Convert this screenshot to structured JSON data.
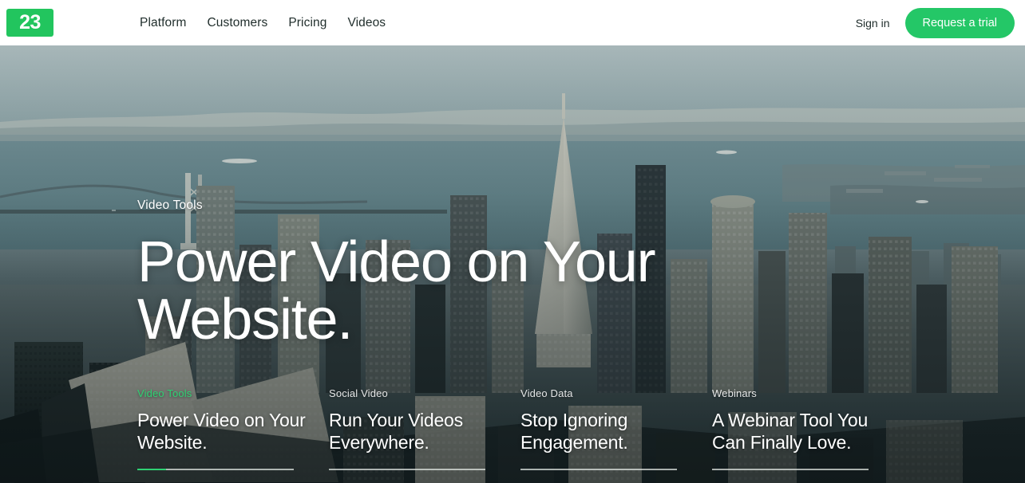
{
  "header": {
    "logo_text": "23",
    "logo_color": "#22c55e",
    "nav": [
      {
        "label": "Platform"
      },
      {
        "label": "Customers"
      },
      {
        "label": "Pricing"
      },
      {
        "label": "Videos"
      }
    ],
    "signin_label": "Sign in",
    "trial_label": "Request a trial",
    "trial_color": "#24c767"
  },
  "hero": {
    "eyebrow": "Video Tools",
    "title": "Power Video on Your Website.",
    "image_alt": "Aerial view of the San Francisco skyline with the Bay Bridge and the Transamerica Pyramid"
  },
  "carousel": {
    "accent_color": "#2fd173",
    "slides": [
      {
        "label": "Video Tools",
        "title": "Power Video on Your Website.",
        "active": true,
        "progress": 18
      },
      {
        "label": "Social Video",
        "title": "Run Your Videos Everywhere.",
        "active": false,
        "progress": 0
      },
      {
        "label": "Video Data",
        "title": "Stop Ignoring Engagement.",
        "active": false,
        "progress": 0
      },
      {
        "label": "Webinars",
        "title": "A Webinar Tool You Can Finally Love.",
        "active": false,
        "progress": 0
      }
    ]
  }
}
